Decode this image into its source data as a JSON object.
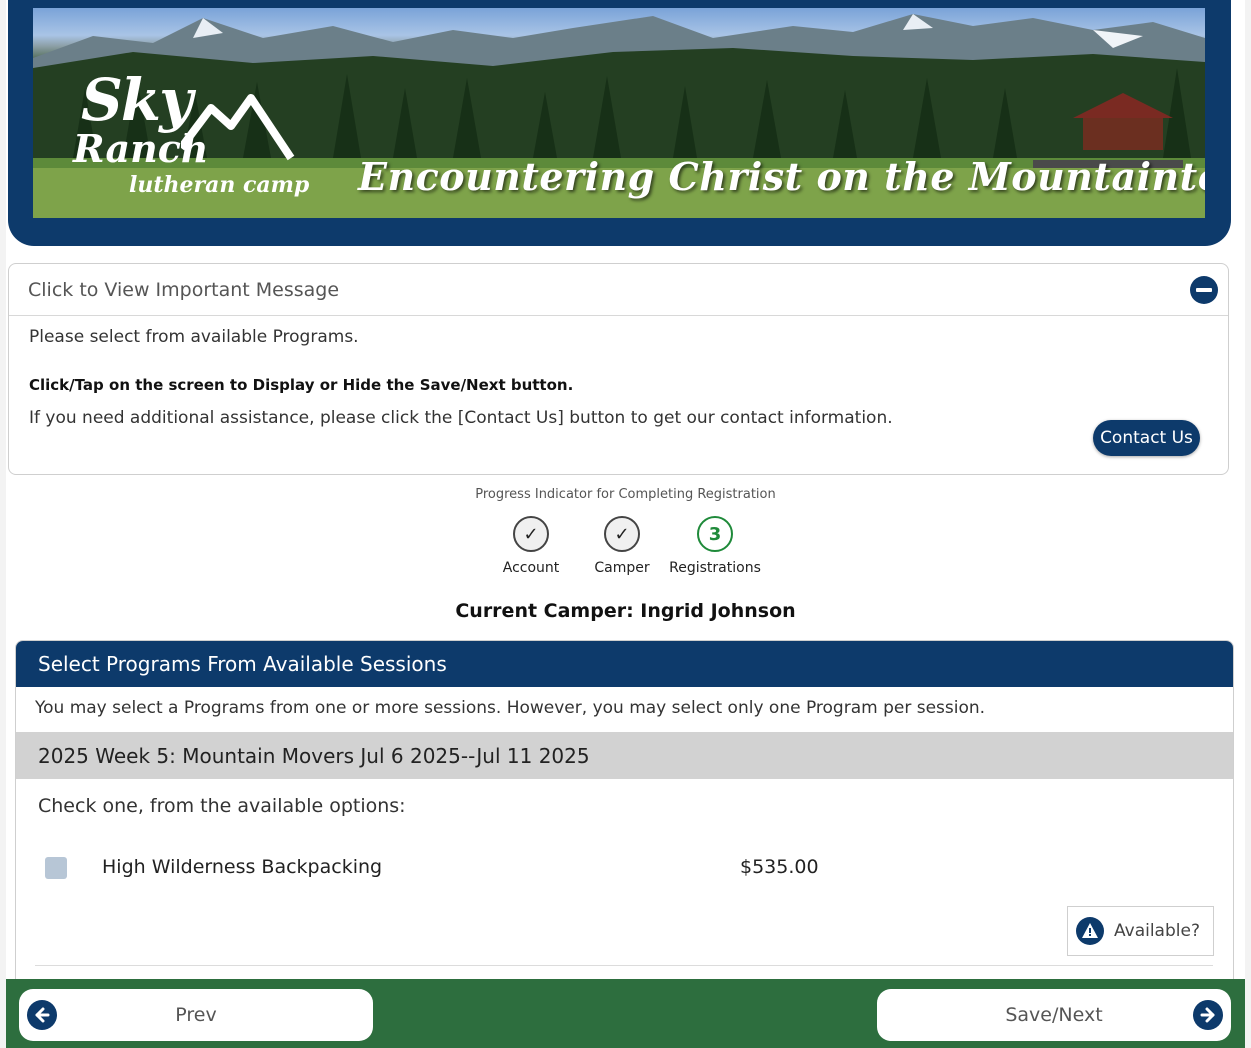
{
  "header": {
    "logo_line1": "Sky",
    "logo_line2": "Ranch",
    "logo_line3": "lutheran camp",
    "tagline": "Encountering Christ on the Mountaintops"
  },
  "message_panel": {
    "title": "Click to View Important Message",
    "line1": "Please select from available Programs.",
    "line2": "Click/Tap on the screen to Display or Hide the Save/Next button.",
    "line3": "If you need additional assistance, please click the [Contact Us] button to get our contact information.",
    "contact_label": "Contact Us"
  },
  "progress": {
    "title": "Progress Indicator for Completing Registration",
    "steps": [
      {
        "label": "Account",
        "mark": "✓"
      },
      {
        "label": "Camper",
        "mark": "✓"
      },
      {
        "label": "Registrations",
        "mark": "3"
      }
    ],
    "current_camper": "Current Camper: Ingrid Johnson"
  },
  "programs": {
    "heading": "Select Programs From Available Sessions",
    "description": "You may select a Programs from one or more sessions. However, you may select only one Program per session.",
    "session_title": "2025 Week 5: Mountain Movers Jul 6 2025--Jul 11 2025",
    "instruction": "Check one, from the available options:",
    "options": [
      {
        "name": "High Wilderness Backpacking",
        "price": "$535.00",
        "checked": false
      }
    ],
    "available_label": "Available?"
  },
  "footer": {
    "prev_label": "Prev",
    "next_label": "Save/Next"
  },
  "colors": {
    "brand_navy": "#0d3a6b",
    "footer_green": "#2d6e3e",
    "active_step_green": "#1f8a3a"
  }
}
